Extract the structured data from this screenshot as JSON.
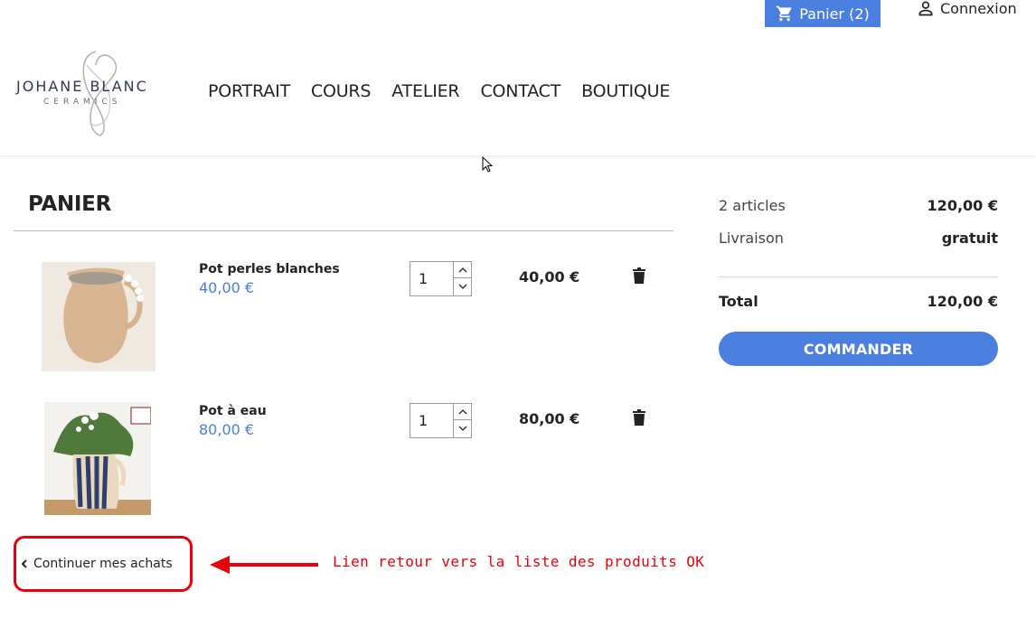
{
  "header": {
    "cart_label": "Panier (2)",
    "login_label": "Connexion",
    "logo_main": "JOHANE BLANC",
    "logo_sub": "CERAMICS",
    "nav": [
      {
        "label": "PORTRAIT"
      },
      {
        "label": "COURS"
      },
      {
        "label": "ATELIER"
      },
      {
        "label": "CONTACT"
      },
      {
        "label": "BOUTIQUE"
      }
    ]
  },
  "cart": {
    "title": "PANIER",
    "items": [
      {
        "name": "Pot perles blanches",
        "unit_price": "40,00 €",
        "quantity": "1",
        "total": "40,00 €"
      },
      {
        "name": "Pot à eau",
        "unit_price": "80,00 €",
        "quantity": "1",
        "total": "80,00 €"
      }
    ],
    "continue_label": "Continuer mes achats"
  },
  "summary": {
    "articles_label": "2 articles",
    "articles_value": "120,00 €",
    "shipping_label": "Livraison",
    "shipping_value": "gratuit",
    "total_label": "Total",
    "total_value": "120,00 €",
    "checkout_label": "COMMANDER"
  },
  "annotation": {
    "text": "Lien retour vers la liste des produits OK",
    "color": "#e8000b"
  },
  "colors": {
    "accent": "#4a7fe0",
    "text": "#232323"
  }
}
